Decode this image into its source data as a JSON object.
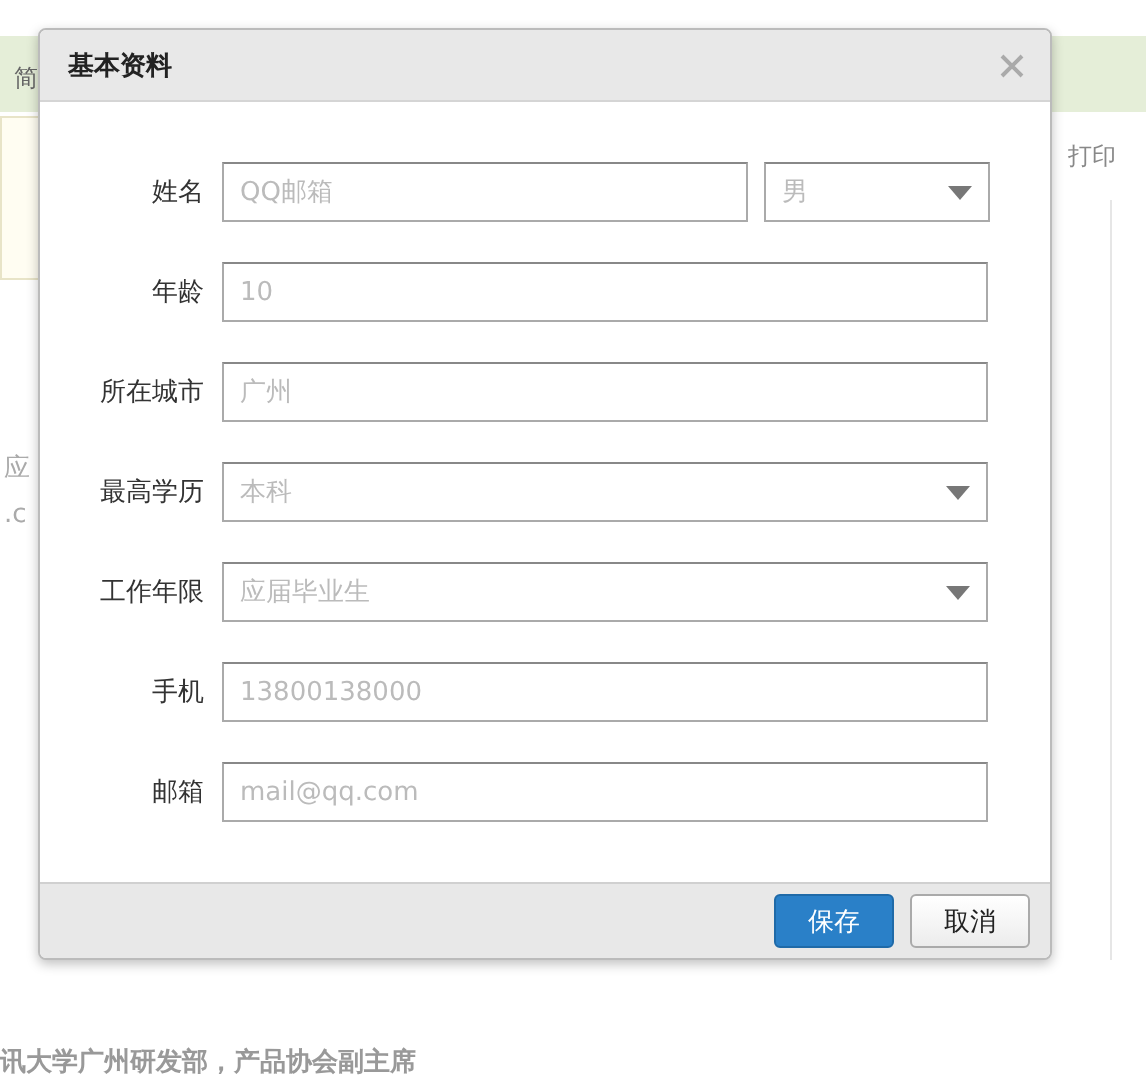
{
  "background": {
    "tab_label": "简",
    "print_link": "打印",
    "fragments": [
      "应",
      ".c"
    ],
    "bottom_text": "讯大学广州研发部，产品协会副主席"
  },
  "dialog": {
    "title": "基本资料",
    "fields": [
      {
        "label": "姓名",
        "controls": [
          {
            "kind": "text",
            "placeholder": "QQ邮箱"
          },
          {
            "kind": "select",
            "value": "男"
          }
        ]
      },
      {
        "label": "年龄",
        "controls": [
          {
            "kind": "text",
            "placeholder": "10"
          }
        ]
      },
      {
        "label": "所在城市",
        "controls": [
          {
            "kind": "text",
            "placeholder": "广州"
          }
        ]
      },
      {
        "label": "最高学历",
        "controls": [
          {
            "kind": "select",
            "value": "本科"
          }
        ]
      },
      {
        "label": "工作年限",
        "controls": [
          {
            "kind": "select",
            "value": "应届毕业生"
          }
        ]
      },
      {
        "label": "手机",
        "controls": [
          {
            "kind": "text",
            "placeholder": "13800138000"
          }
        ]
      },
      {
        "label": "邮箱",
        "controls": [
          {
            "kind": "text",
            "placeholder": "mail@qq.com"
          }
        ]
      }
    ],
    "buttons": [
      {
        "label": "保存",
        "kind": "primary"
      },
      {
        "label": "取消",
        "kind": "default"
      }
    ]
  }
}
